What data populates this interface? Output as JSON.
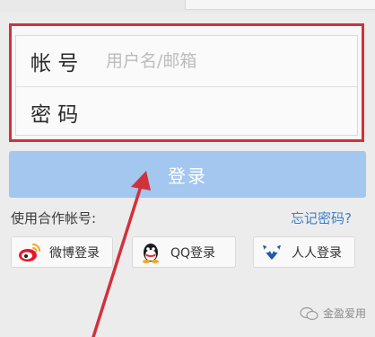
{
  "form": {
    "account_label": "帐 号",
    "account_placeholder": "用户名/邮箱",
    "account_value": "",
    "password_label": "密 码",
    "password_value": ""
  },
  "login": {
    "button_label": "登录"
  },
  "other_accounts": {
    "label": "使用合作帐号:",
    "forgot_password": "忘记密码?"
  },
  "social": {
    "weibo_label": "微博登录",
    "qq_label": "QQ登录",
    "renren_label": "人人登录"
  },
  "icons": {
    "weibo": "weibo-icon",
    "qq": "qq-icon",
    "renren": "renren-icon",
    "watermark": "wechat-icon"
  },
  "colors": {
    "highlight_border": "#d2313a",
    "login_button": "#a3c7ef",
    "link": "#3d7fc8",
    "arrow": "#d2313a"
  },
  "watermark": {
    "text": "金盈爱用"
  }
}
